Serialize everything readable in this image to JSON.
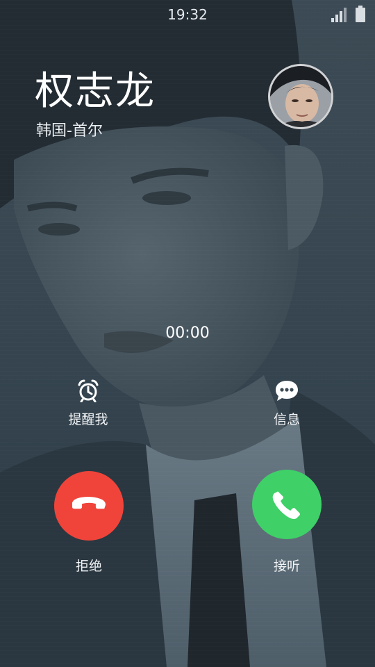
{
  "status_bar": {
    "time": "19:32",
    "signal_icon": "signal-icon",
    "battery_icon": "battery-icon"
  },
  "caller": {
    "name": "权志龙",
    "location": "韩国-首尔"
  },
  "call": {
    "timer": "00:00"
  },
  "actions": {
    "remind": {
      "label": "提醒我",
      "icon": "alarm-clock-icon"
    },
    "message": {
      "label": "信息",
      "icon": "chat-bubble-icon"
    }
  },
  "buttons": {
    "decline": {
      "label": "拒绝",
      "icon": "hang-up-icon",
      "color": "#f0443a"
    },
    "answer": {
      "label": "接听",
      "icon": "phone-icon",
      "color": "#3fd068"
    }
  }
}
